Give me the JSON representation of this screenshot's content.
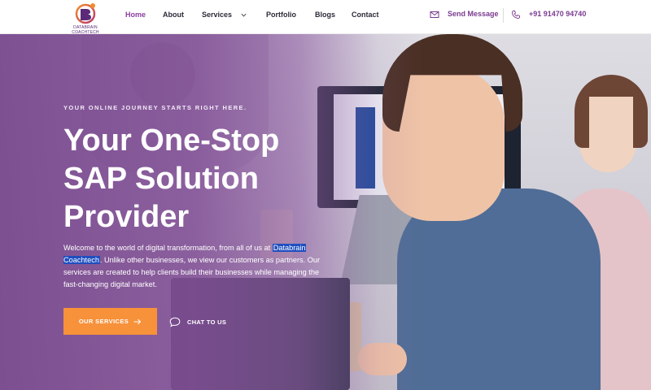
{
  "brand": {
    "logo_text": "DATABRAIN COACHTECH",
    "accent": "#8a3f9e",
    "cta_color": "#f7913a"
  },
  "nav": {
    "items": [
      {
        "label": "Home",
        "active": true
      },
      {
        "label": "About"
      },
      {
        "label": "Services",
        "has_dropdown": true
      },
      {
        "label": "Portfolio"
      },
      {
        "label": "Blogs"
      },
      {
        "label": "Contact"
      }
    ]
  },
  "contact": {
    "message_label": "Send Message",
    "phone": "+91 91470 94740",
    "icons": [
      "envelope-icon",
      "phone-icon"
    ]
  },
  "hero": {
    "eyebrow": "YOUR ONLINE JOURNEY STARTS RIGHT HERE.",
    "headline_lines": [
      "Your One-Stop",
      "SAP Solution",
      "Provider"
    ],
    "para_before": "Welcome to the world of digital transformation, from all of us at",
    "para_highlight": "Databrain Coachtech",
    "para_after": ". Unlike other businesses, we view our customers as partners. Our services are created to help clients build their businesses while managing the fast-changing digital market.",
    "primary_button": "OUR SERVICES",
    "secondary_button": "CHAT TO US"
  }
}
